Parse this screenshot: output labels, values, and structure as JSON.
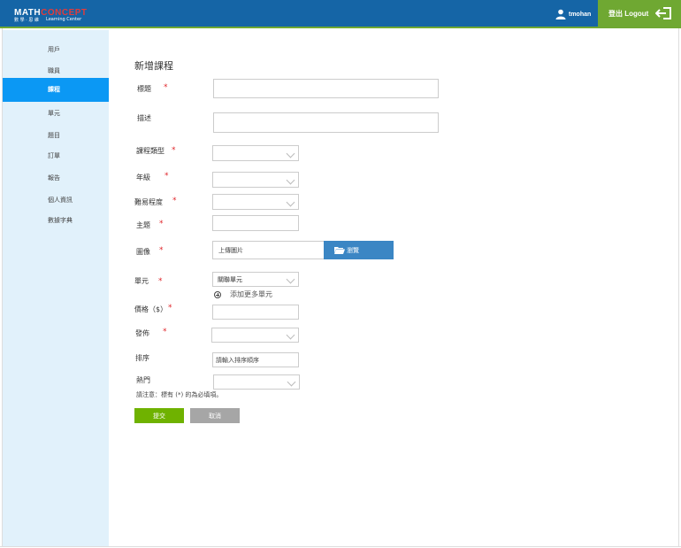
{
  "header": {
    "logo_math": "MATH",
    "logo_concept": "CONCEPT",
    "logo_sub": "數 學 · 思 維",
    "logo_lc": "Learning Center",
    "username": "tmohan",
    "logout_label": "登出 Logout"
  },
  "sidebar": {
    "items": [
      {
        "label": "用戶"
      },
      {
        "label": "職員"
      },
      {
        "label": "課程"
      },
      {
        "label": "單元"
      },
      {
        "label": "題目"
      },
      {
        "label": "訂單"
      },
      {
        "label": "報告"
      },
      {
        "label": "個人資訊"
      },
      {
        "label": "數據字典"
      }
    ],
    "active_index": 2
  },
  "form": {
    "title": "新增課程",
    "fields": {
      "title_label": "標題",
      "description_label": "描述",
      "course_type_label": "課程類型",
      "grade_label": "年級",
      "difficulty_label": "難易程度",
      "topic_label": "主題",
      "image_label": "圖像",
      "image_placeholder": "上傳圖片",
      "browse_label": "瀏覽",
      "unit_label": "單元",
      "unit_select_value": "關聯單元",
      "add_more_units": "添加更多單元",
      "price_label": "價格（$）",
      "publish_label": "發佈",
      "sort_label": "排序",
      "sort_placeholder": "請輸入排序順序",
      "hot_label": "熱門"
    },
    "required_mark": "*",
    "note": "請注意：標有 (*) 的為必填項。",
    "submit_label": "提交",
    "cancel_label": "取消"
  },
  "colors": {
    "header_bg": "#1565a6",
    "accent_green": "#6fa832",
    "active_nav": "#0b98f4",
    "sidebar_bg": "#e1f1fb",
    "browse_button": "#3b86c4",
    "submit_button": "#6fb200",
    "cancel_button": "#a6a6a6",
    "required": "#e0262b"
  }
}
